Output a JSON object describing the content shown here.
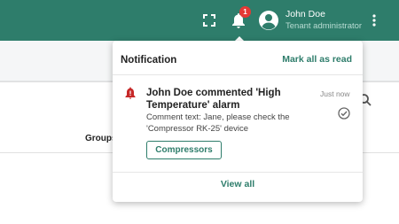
{
  "header": {
    "notification_count": "1",
    "user_name": "John Doe",
    "user_role": "Tenant administrator",
    "icons": [
      "fullscreen-icon",
      "bell-icon",
      "account-circle-icon",
      "more-vert-icon"
    ]
  },
  "background": {
    "groups_label": "Groups"
  },
  "notifications": {
    "title": "Notification",
    "mark_all_label": "Mark all as read",
    "view_all_label": "View all",
    "items": [
      {
        "icon": "alarm-bell-icon",
        "title": "John Doe commented 'High Temperature' alarm",
        "time": "Just now",
        "text": "Comment text: Jane, please check the 'Compressor RK-25' device",
        "button_label": "Compressors"
      }
    ]
  },
  "colors": {
    "primary": "#2e7d6b",
    "badge": "#e53935",
    "alarm": "#c62828"
  }
}
